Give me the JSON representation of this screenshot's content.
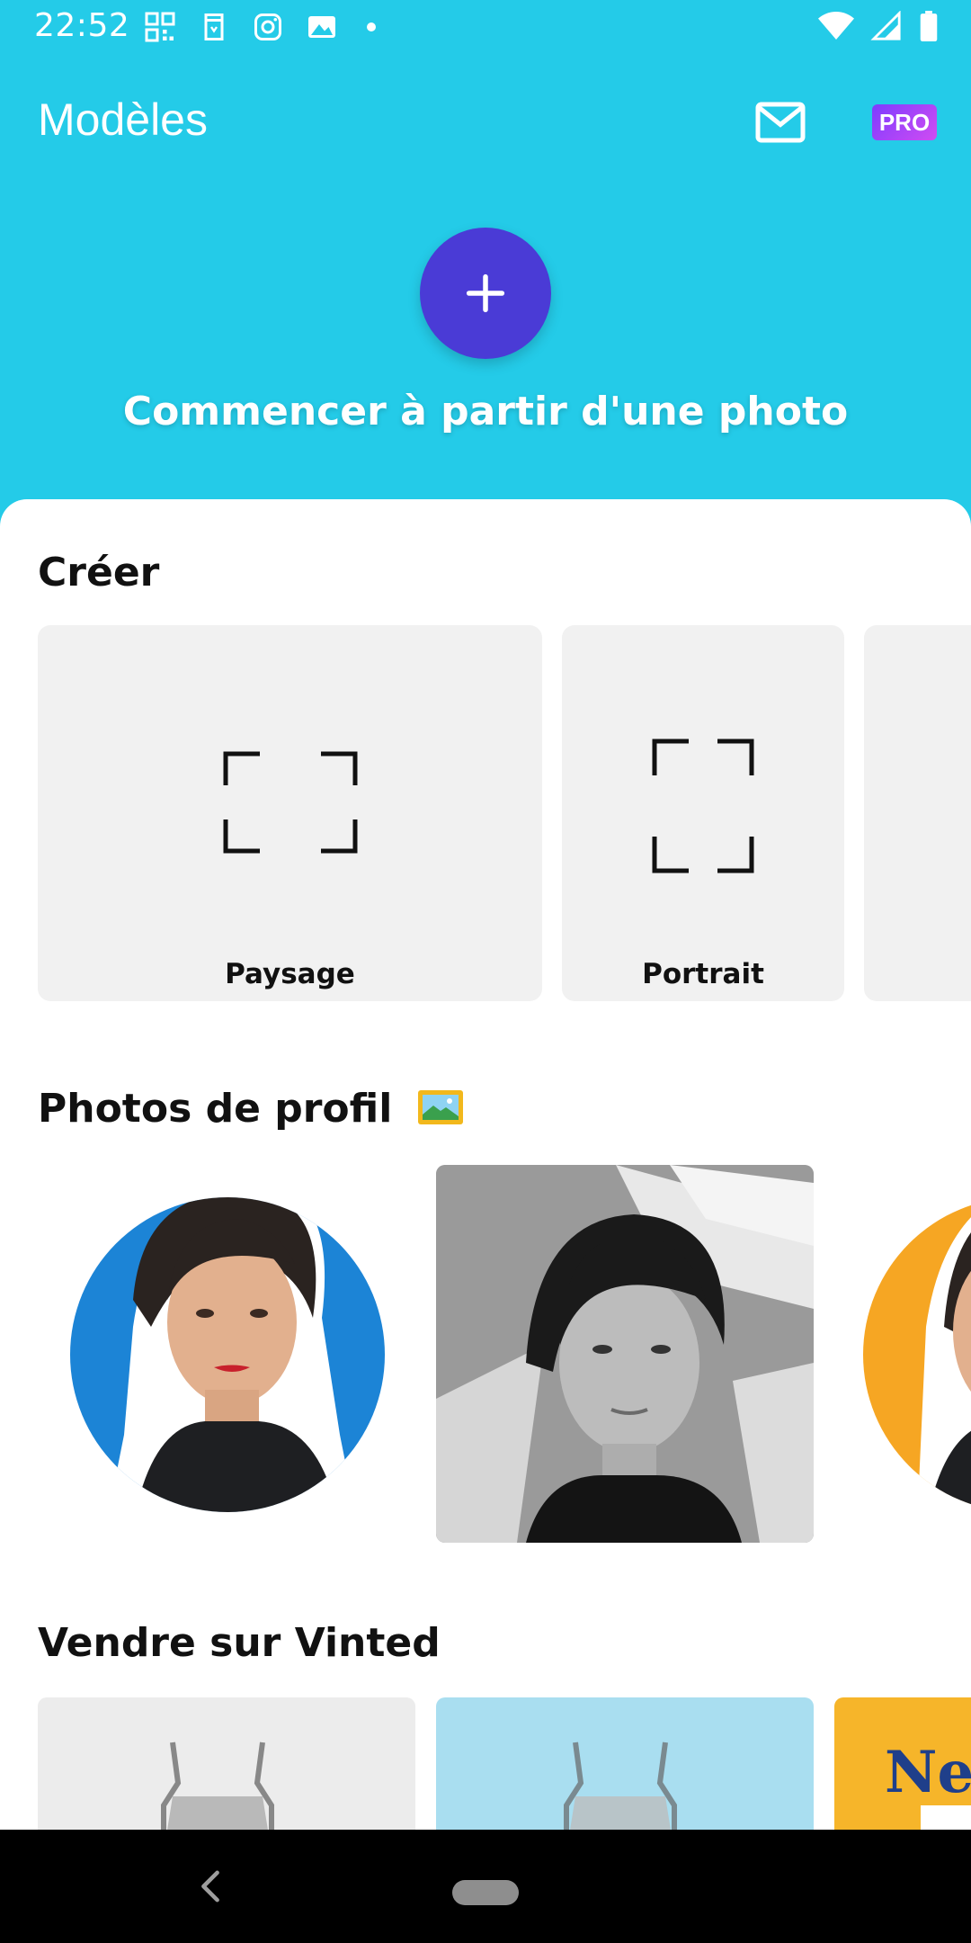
{
  "status_bar": {
    "time": "22:52",
    "left_icons": [
      "qr-code-icon",
      "shopping-bag-icon",
      "instagram-icon",
      "gallery-icon",
      "notification-dot-icon"
    ],
    "right_icons": [
      "wifi-icon",
      "signal-icon",
      "battery-icon"
    ]
  },
  "app_bar": {
    "title": "Modèles",
    "pro_label": "PRO"
  },
  "hero": {
    "fab_symbol": "+",
    "cta": "Commencer à partir d'une photo"
  },
  "sections": {
    "create": {
      "title": "Créer",
      "cards": [
        {
          "label": "Paysage"
        },
        {
          "label": "Portrait"
        }
      ]
    },
    "profile_photos": {
      "title": "Photos de profil",
      "emoji": "🖼️"
    },
    "vinted": {
      "title": "Vendre sur Vinted",
      "third_card_text": "New"
    }
  },
  "colors": {
    "header_bg": "#24cbe8",
    "fab": "#4a3bd6",
    "pro_gradient_start": "#7d3cff",
    "pro_gradient_end": "#d04cf2",
    "card_bg": "#f1f1f1"
  }
}
